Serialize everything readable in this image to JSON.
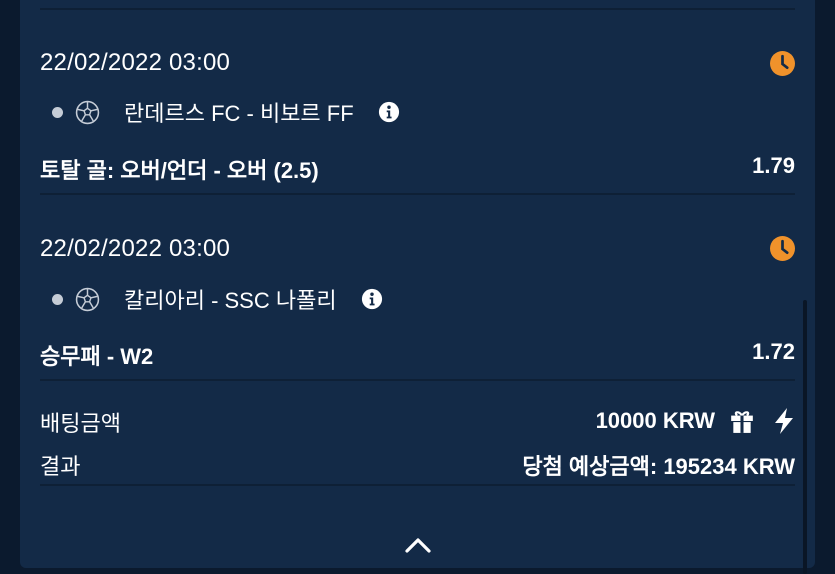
{
  "bets": [
    {
      "datetime": "22/02/2022 03:00",
      "sport_icon": "soccer-ball-icon",
      "match": "란데르스 FC - 비보르 FF",
      "market": "토탈 골: 오버/언더 - 오버 (2.5)",
      "odds": "1.79"
    },
    {
      "datetime": "22/02/2022 03:00",
      "sport_icon": "soccer-ball-icon",
      "match": "칼리아리 - SSC 나폴리",
      "market": "승무패 - W2",
      "odds": "1.72"
    }
  ],
  "summary": {
    "stake_label": "배팅금액",
    "stake_value": "10000 KRW",
    "result_label": "결과",
    "potential_win": "당첨 예상금액: 195234 KRW"
  },
  "colors": {
    "background": "#0b1a2e",
    "panel": "#132a47",
    "clock_accent": "#f0922b",
    "text": "#ffffff"
  },
  "icons": [
    "clock-icon",
    "soccer-ball-icon",
    "info-icon",
    "gift-icon",
    "lightning-icon",
    "chevron-up-icon"
  ]
}
